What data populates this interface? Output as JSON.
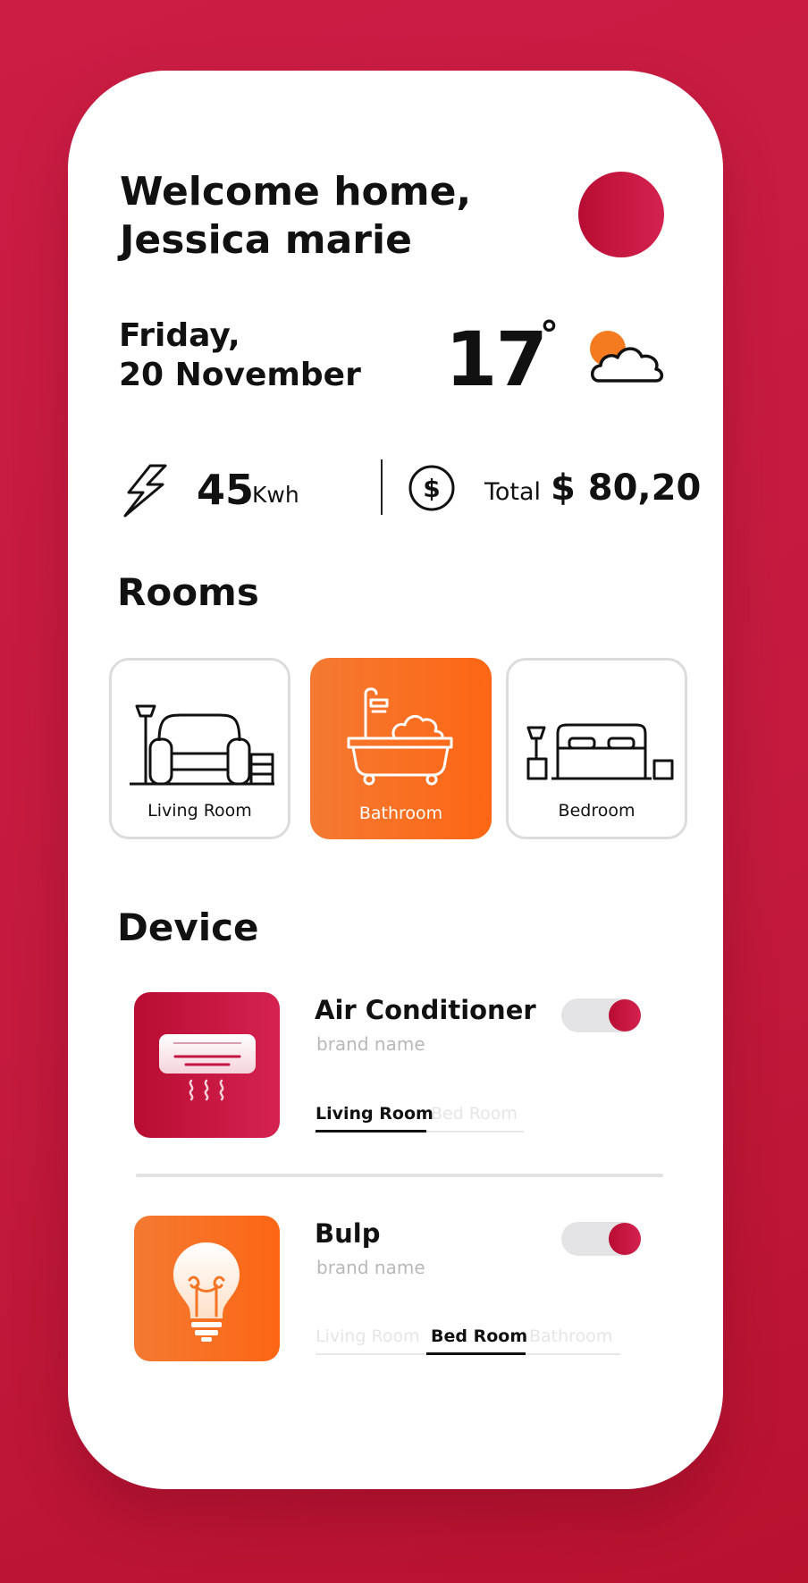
{
  "header": {
    "welcome_line1": "Welcome home,",
    "welcome_line2": "Jessica marie"
  },
  "weather": {
    "date_line1": "Friday,",
    "date_line2": "20 November",
    "temperature": "17",
    "degree_symbol": "°",
    "condition_icon": "partly-cloudy-icon"
  },
  "energy": {
    "usage_value": "45",
    "usage_unit": "Kwh",
    "total_label": "Total",
    "total_value": "$ 80,20",
    "usage_icon": "lightning-icon",
    "cost_icon": "dollar-icon"
  },
  "rooms": {
    "title": "Rooms",
    "items": [
      {
        "label": "Living Room",
        "icon": "sofa-icon",
        "active": false
      },
      {
        "label": "Bathroom",
        "icon": "bathtub-icon",
        "active": true
      },
      {
        "label": "Bedroom",
        "icon": "bed-icon",
        "active": false
      }
    ]
  },
  "devices": {
    "title": "Device",
    "items": [
      {
        "name": "Air Conditioner",
        "brand": "brand name",
        "icon": "air-conditioner-icon",
        "enabled": true,
        "tabs": [
          "Living Room",
          "Bed Room"
        ],
        "selected_tab": "Living Room"
      },
      {
        "name": "Bulp",
        "brand": "brand name",
        "icon": "lightbulb-icon",
        "enabled": true,
        "tabs": [
          "Living Room",
          "Bed Room",
          "Bathroom"
        ],
        "selected_tab": "Bed Room"
      }
    ]
  },
  "colors": {
    "background": "#c71c42",
    "primary_red": "#c41540",
    "accent_orange": "#fb6a1b",
    "sun_orange": "#f47b20"
  }
}
